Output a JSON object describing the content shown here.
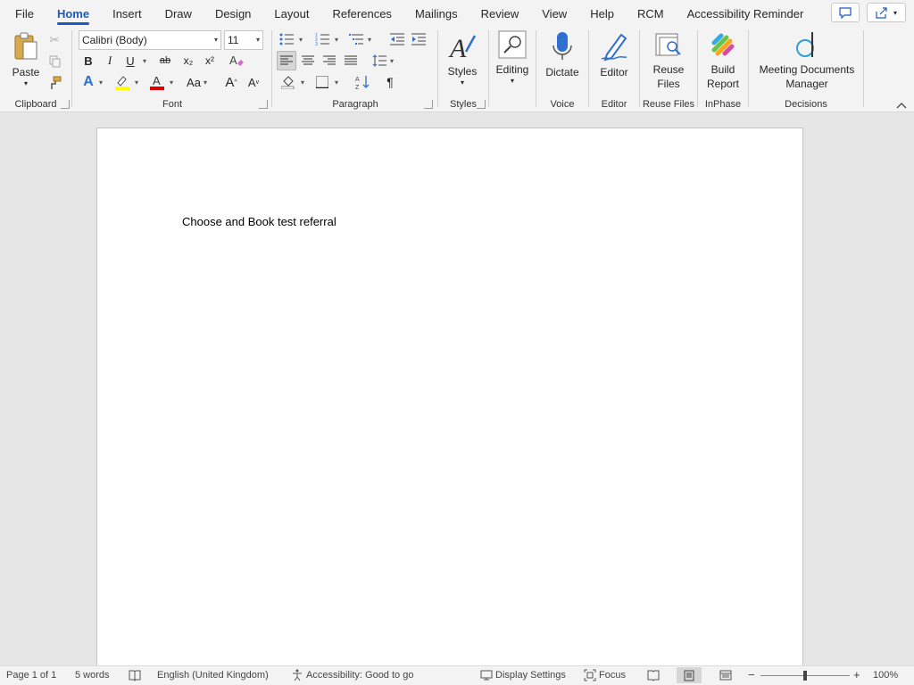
{
  "menu": {
    "tabs": [
      "File",
      "Home",
      "Insert",
      "Draw",
      "Design",
      "Layout",
      "References",
      "Mailings",
      "Review",
      "View",
      "Help",
      "RCM",
      "Accessibility Reminder"
    ],
    "active": "Home"
  },
  "ribbon": {
    "clipboard": {
      "label": "Clipboard",
      "paste": "Paste"
    },
    "font": {
      "label": "Font",
      "family": "Calibri (Body)",
      "size": "11",
      "bold": "B",
      "italic": "I",
      "underline": "U",
      "strike": "ab",
      "sub": "x₂",
      "sup": "x²",
      "textEffects": "A",
      "fontColor": "A",
      "changeCase": "Aa",
      "grow": "A",
      "shrink": "A"
    },
    "paragraph": {
      "label": "Paragraph",
      "pilcrow": "¶"
    },
    "styles": {
      "label": "Styles",
      "button": "Styles"
    },
    "editing": {
      "button": "Editing"
    },
    "voice": {
      "label": "Voice",
      "button": "Dictate"
    },
    "editor": {
      "label": "Editor",
      "button": "Editor"
    },
    "reuse": {
      "label": "Reuse Files",
      "button_l1": "Reuse",
      "button_l2": "Files"
    },
    "inphase": {
      "label": "InPhase",
      "button_l1": "Build",
      "button_l2": "Report"
    },
    "decisions": {
      "label": "Decisions",
      "button_l1": "Meeting Documents",
      "button_l2": "Manager"
    }
  },
  "document": {
    "text": "Choose and Book test referral"
  },
  "status": {
    "page": "Page 1 of 1",
    "words": "5 words",
    "language": "English (United Kingdom)",
    "accessibility": "Accessibility: Good to go",
    "display": "Display Settings",
    "focus": "Focus",
    "zoom": "100%",
    "zoom_minus": "−",
    "zoom_plus": "+"
  },
  "colors": {
    "accent": "#185abd",
    "highlight": "#ffff00",
    "fontColor": "#ff0000"
  }
}
